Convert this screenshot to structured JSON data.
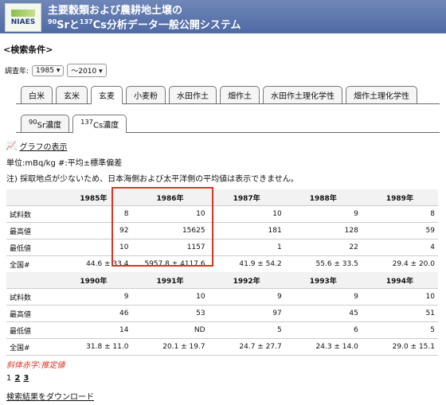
{
  "header": {
    "logo": "NIAES",
    "title_line1": "主要穀類および農耕地土壌の",
    "title_line2_a": "90",
    "title_line2_b": "Srと",
    "title_line2_c": "137",
    "title_line2_d": "Cs分析データ一般公開システム"
  },
  "search": {
    "section": "<検索条件>",
    "year_label": "調査年:",
    "from_year": "1985",
    "to_year": "〜2010"
  },
  "tabs": [
    "白米",
    "玄米",
    "玄麦",
    "小麦粉",
    "水田作土",
    "畑作土",
    "水田作土理化学性",
    "畑作土理化学性"
  ],
  "active_tab": "玄麦",
  "subtabs": [
    "90Sr濃度",
    "137Cs濃度"
  ],
  "graph_link": "グラフの表示",
  "unit_text": "単位:mBq/kg #:平均±標準偏差",
  "note_text": "注) 採取地点が少ないため、日本海側および太平洋側の平均値は表示できません。",
  "table1": {
    "years": [
      "1985年",
      "1986年",
      "1987年",
      "1988年",
      "1989年"
    ],
    "rows": [
      {
        "label": "試料数",
        "v": [
          "8",
          "10",
          "10",
          "9",
          "8"
        ]
      },
      {
        "label": "最高値",
        "v": [
          "92",
          "15625",
          "181",
          "128",
          "59"
        ]
      },
      {
        "label": "最低値",
        "v": [
          "10",
          "1157",
          "1",
          "22",
          "4"
        ]
      },
      {
        "label": "全国#",
        "v": [
          "44.6 ± 33.4",
          "5957.8 ± 4117.6",
          "41.9 ± 54.2",
          "55.6 ± 33.5",
          "29.4 ± 20.0"
        ]
      }
    ]
  },
  "table2": {
    "years": [
      "1990年",
      "1991年",
      "1992年",
      "1993年",
      "1994年"
    ],
    "rows": [
      {
        "label": "試料数",
        "v": [
          "9",
          "10",
          "9",
          "9",
          "10"
        ]
      },
      {
        "label": "最高値",
        "v": [
          "46",
          "53",
          "97",
          "45",
          "51"
        ]
      },
      {
        "label": "最低値",
        "v": [
          "14",
          "ND",
          "5",
          "6",
          "5"
        ]
      },
      {
        "label": "全国#",
        "v": [
          "31.8 ± 11.0",
          "20.1 ± 19.7",
          "24.7 ± 27.7",
          "24.3 ± 14.0",
          "29.0 ± 15.1"
        ]
      }
    ]
  },
  "estimate_note": "斜体赤字:推定値",
  "pager": [
    "1",
    "2",
    "3"
  ],
  "download_link": "検索結果をダウンロード"
}
